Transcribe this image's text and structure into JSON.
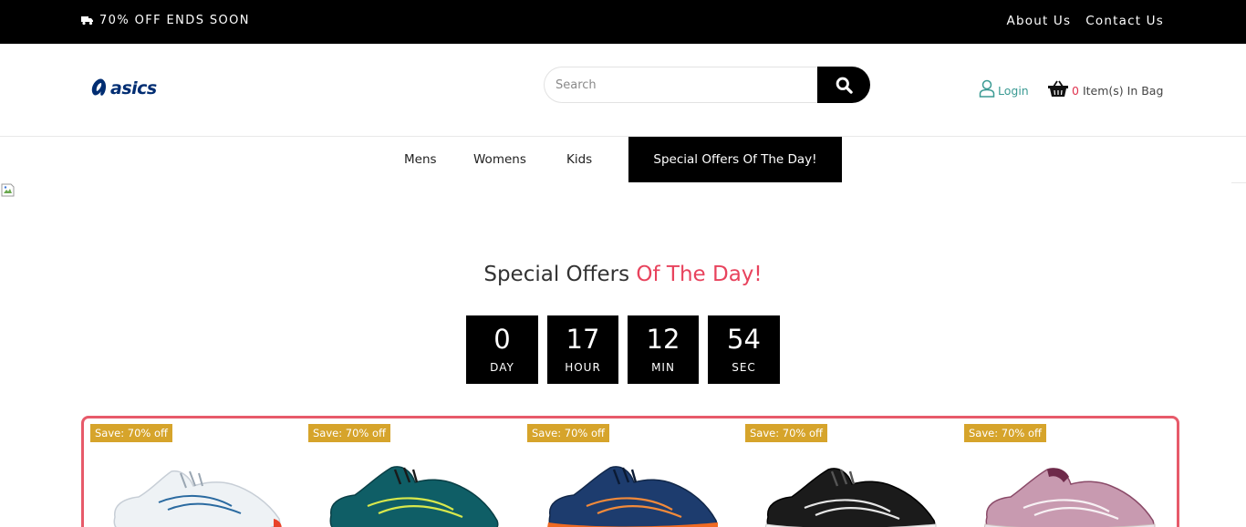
{
  "topbar": {
    "promo_text": "70% OFF ENDS SOON",
    "links": [
      "About Us",
      "Contact Us"
    ]
  },
  "header": {
    "logo_text": "asics",
    "search": {
      "placeholder": "Search",
      "value": ""
    },
    "login_label": "Login",
    "bag": {
      "count": "0",
      "label": "Item(s) In Bag"
    }
  },
  "nav": {
    "items": [
      "Mens",
      "Womens",
      "Kids"
    ],
    "special_label": "Special Offers Of The Day!"
  },
  "offers": {
    "title_plain": "Special Offers ",
    "title_accent": "Of The Day!",
    "countdown": [
      {
        "value": "0",
        "label": "DAY"
      },
      {
        "value": "17",
        "label": "HOUR"
      },
      {
        "value": "12",
        "label": "MIN"
      },
      {
        "value": "54",
        "label": "SEC"
      }
    ]
  },
  "products": [
    {
      "badge": "Save: 70% off",
      "icon": "white-running-shoe"
    },
    {
      "badge": "Save: 70% off",
      "icon": "teal-running-shoe"
    },
    {
      "badge": "Save: 70% off",
      "icon": "navy-orange-running-shoe"
    },
    {
      "badge": "Save: 70% off",
      "icon": "black-running-shoe"
    },
    {
      "badge": "Save: 70% off",
      "icon": "pink-running-shoe"
    }
  ],
  "colors": {
    "accent": "#e8435d",
    "badge": "#d6a42b",
    "login": "#3a9a93",
    "black": "#000000"
  }
}
